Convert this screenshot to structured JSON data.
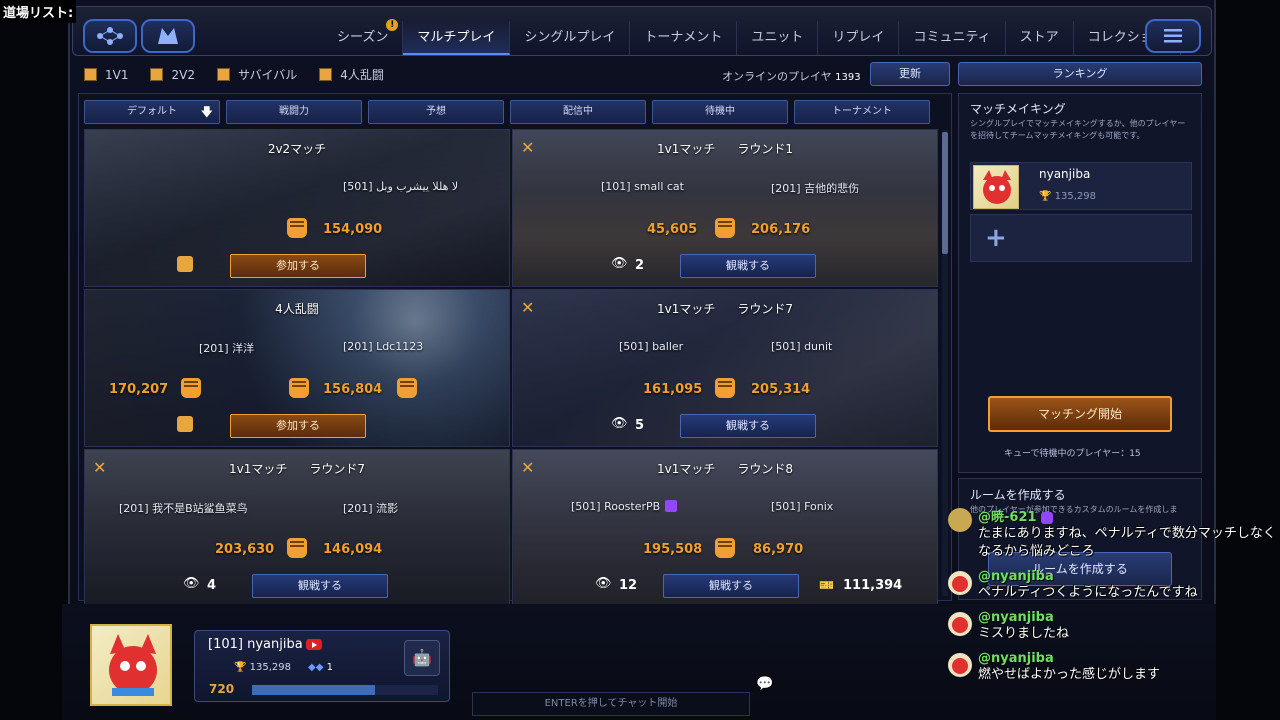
{
  "overlay": {
    "title": "道場リスト:"
  },
  "nav": {
    "tabs": [
      {
        "label": "シーズン",
        "alert": "!"
      },
      {
        "label": "マルチプレイ"
      },
      {
        "label": "シングルプレイ"
      },
      {
        "label": "トーナメント"
      },
      {
        "label": "ユニット"
      },
      {
        "label": "リプレイ"
      },
      {
        "label": "コミュニティ"
      },
      {
        "label": "ストア"
      },
      {
        "label": "コレクション"
      }
    ],
    "active_tab": "マルチプレイ"
  },
  "filters": [
    "1V1",
    "2V2",
    "サバイバル",
    "4人乱闘"
  ],
  "online": {
    "label": "オンラインのプレイヤ",
    "count": "1393"
  },
  "buttons": {
    "update": "更新",
    "ranking": "ランキング"
  },
  "sort": [
    "デフォルト",
    "戦闘力",
    "予想",
    "配信中",
    "待機中",
    "トーナメント"
  ],
  "matches": [
    {
      "title": "2v2マッチ",
      "round": "",
      "p1": "",
      "p2": "[501] لا هللا ييشرب وبل",
      "s1": "",
      "s2": "154,090",
      "action": "参加する",
      "viewers": ""
    },
    {
      "title": "1v1マッチ",
      "round": "ラウンド1",
      "p1": "[101] small cat",
      "p2": "[201] 吉他的悲伤",
      "s1": "45,605",
      "s2": "206,176",
      "action": "観戦する",
      "viewers": "2"
    },
    {
      "title": "4人乱闘",
      "round": "",
      "p1": "[201] 洋洋",
      "p2": "[201] Ldc1123",
      "s1": "170,207",
      "s2": "156,804",
      "action": "参加する",
      "viewers": ""
    },
    {
      "title": "1v1マッチ",
      "round": "ラウンド7",
      "p1": "[501] baller",
      "p2": "[501] dunit",
      "s1": "161,095",
      "s2": "205,314",
      "action": "観戦する",
      "viewers": "5"
    },
    {
      "title": "1v1マッチ",
      "round": "ラウンド7",
      "p1": "[201] 我不是B站鲨鱼菜鸟",
      "p2": "[201] 流影",
      "s1": "203,630",
      "s2": "146,094",
      "action": "観戦する",
      "viewers": "4"
    },
    {
      "title": "1v1マッチ",
      "round": "ラウンド8",
      "p1": "[501] RoosterPB",
      "p2": "[501] Fonix",
      "s1": "195,508",
      "s2": "86,970",
      "action": "観戦する",
      "viewers": "12",
      "extra": "111,394"
    }
  ],
  "matchmaking": {
    "title": "マッチメイキング",
    "desc": "シングルプレイでマッチメイキングするか、他のプレイヤーを招待してチームマッチメイキングも可能です。",
    "player_name": "nyanjiba",
    "player_points": "135,298",
    "add": "+",
    "start": "マッチング開始",
    "queue": "キューで待機中のプレイヤー：15"
  },
  "room": {
    "title": "ルームを作成する",
    "desc": "他のプレイヤーが参加できるカスタムのルームを作成しま",
    "button": "ルームを作成する"
  },
  "me": {
    "name": "[101] nyanjiba",
    "points": "135,298",
    "diamonds": "1",
    "level": "720",
    "xp_fraction": 0.66
  },
  "chat_input": {
    "placeholder": "ENTERを押してチャット開始"
  },
  "stream_chat": [
    {
      "user": "@暁-621",
      "text": "たまにありますね、ペナルティで数分マッチしなくなるから悩みどころ"
    },
    {
      "user": "@nyanjiba",
      "text": "ペナルティつくようになったんですね"
    },
    {
      "user": "@nyanjiba",
      "text": "ミスりましたね"
    },
    {
      "user": "@nyanjiba",
      "text": "燃やせばよかった感じがします"
    }
  ],
  "colors": {
    "accent": "#e8a640",
    "primary": "#3d67c8",
    "chat_user": "#6de05e"
  }
}
